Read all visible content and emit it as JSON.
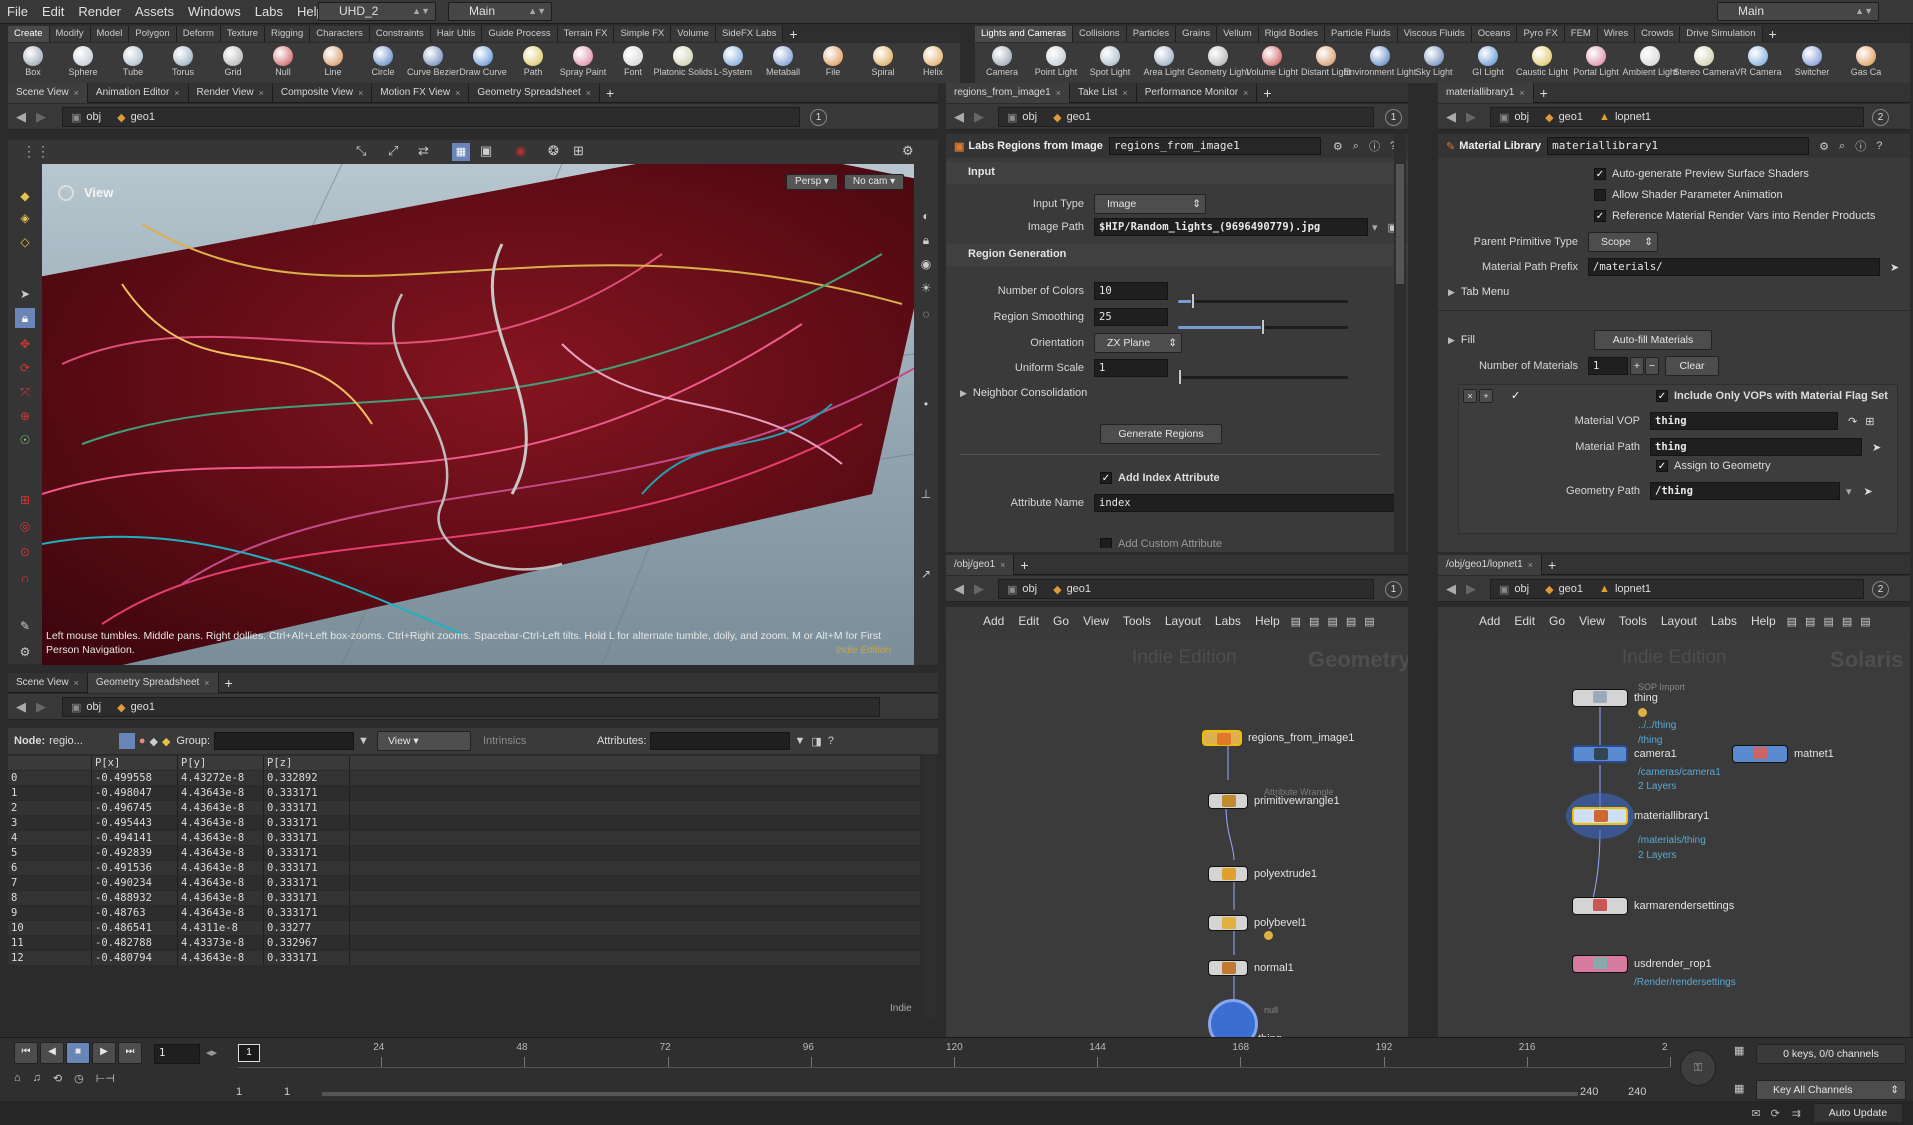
{
  "menu": {
    "items": [
      "File",
      "Edit",
      "Render",
      "Assets",
      "Windows",
      "Labs",
      "Help"
    ],
    "desktop": "UHD_2",
    "desk_main": "Main",
    "right_desk": "Main"
  },
  "shelf_left": {
    "tabs": [
      "Create",
      "Modify",
      "Model",
      "Polygon",
      "Deform",
      "Texture",
      "Rigging",
      "Characters",
      "Constraints",
      "Hair Utils",
      "Guide Process",
      "Terrain FX",
      "Simple FX",
      "Volume",
      "SideFX Labs"
    ],
    "tools": [
      "Box",
      "Sphere",
      "Tube",
      "Torus",
      "Grid",
      "Null",
      "Line",
      "Circle",
      "Curve Bezier",
      "Draw Curve",
      "Path",
      "Spray Paint",
      "Font",
      "Platonic Solids",
      "L-System",
      "Metaball",
      "File",
      "Spiral",
      "Helix"
    ]
  },
  "shelf_right": {
    "tabs": [
      "Lights and Cameras",
      "Collisions",
      "Particles",
      "Grains",
      "Vellum",
      "Rigid Bodies",
      "Particle Fluids",
      "Viscous Fluids",
      "Oceans",
      "Pyro FX",
      "FEM",
      "Wires",
      "Crowds",
      "Drive Simulation"
    ],
    "tools": [
      "Camera",
      "Point Light",
      "Spot Light",
      "Area Light",
      "Geometry Light",
      "Volume Light",
      "Distant Light",
      "Environment Light",
      "Sky Light",
      "GI Light",
      "Caustic Light",
      "Portal Light",
      "Ambient Light",
      "Stereo Camera",
      "VR Camera",
      "Switcher",
      "Gas Ca"
    ]
  },
  "viewer": {
    "tabs": [
      "Scene View",
      "Animation Editor",
      "Render View",
      "Composite View",
      "Motion FX View",
      "Geometry Spreadsheet"
    ],
    "path_obj": "obj",
    "path_geo": "geo1",
    "label": "View",
    "persp": "Persp",
    "cam": "No cam",
    "help": "Left mouse tumbles. Middle pans. Right dollies. Ctrl+Alt+Left box-zooms. Ctrl+Right zooms. Spacebar-Ctrl-Left tilts. Hold L for alternate tumble, dolly, and zoom. M or Alt+M for First Person Navigation.",
    "indie": "Indie Edition",
    "circ": "1"
  },
  "sheet": {
    "tabs": [
      "Scene View",
      "Geometry Spreadsheet"
    ],
    "node_label": "Node:",
    "node_name": "regio...",
    "group_label": "Group:",
    "view": "View",
    "intrinsics": "Intrinsics",
    "attributes": "Attributes:",
    "columns": [
      "",
      "P[x]",
      "P[y]",
      "P[z]"
    ],
    "rows": [
      [
        "0",
        "-0.499558",
        "4.43272e-8",
        "0.332892"
      ],
      [
        "1",
        "-0.498047",
        "4.43643e-8",
        "0.333171"
      ],
      [
        "2",
        "-0.496745",
        "4.43643e-8",
        "0.333171"
      ],
      [
        "3",
        "-0.495443",
        "4.43643e-8",
        "0.333171"
      ],
      [
        "4",
        "-0.494141",
        "4.43643e-8",
        "0.333171"
      ],
      [
        "5",
        "-0.492839",
        "4.43643e-8",
        "0.333171"
      ],
      [
        "6",
        "-0.491536",
        "4.43643e-8",
        "0.333171"
      ],
      [
        "7",
        "-0.490234",
        "4.43643e-8",
        "0.333171"
      ],
      [
        "8",
        "-0.488932",
        "4.43643e-8",
        "0.333171"
      ],
      [
        "9",
        "-0.48763",
        "4.43643e-8",
        "0.333171"
      ],
      [
        "10",
        "-0.486541",
        "4.4311e-8",
        "0.33277"
      ],
      [
        "11",
        "-0.482788",
        "4.43373e-8",
        "0.332967"
      ],
      [
        "12",
        "-0.480794",
        "4.43643e-8",
        "0.333171"
      ]
    ],
    "indie": "Indie"
  },
  "params": {
    "tabs": [
      "regions_from_image1",
      "Take List",
      "Performance Monitor"
    ],
    "path_obj": "obj",
    "path_geo": "geo1",
    "circ": "1",
    "type": "Labs Regions from Image",
    "name": "regions_from_image1",
    "input_section": "Input",
    "input_type_label": "Input Type",
    "input_type": "Image",
    "image_path_label": "Image Path",
    "image_path": "$HIP/Random_lights_(9696490779).jpg",
    "region_section": "Region Generation",
    "num_colors_label": "Number of Colors",
    "num_colors": "10",
    "smoothing_label": "Region Smoothing",
    "smoothing": "25",
    "orient_label": "Orientation",
    "orient": "ZX Plane",
    "uscale_label": "Uniform Scale",
    "uscale": "1",
    "neighbor": "Neighbor Consolidation",
    "generate": "Generate Regions",
    "add_index": "Add Index Attribute",
    "attr_name_label": "Attribute Name",
    "attr_name": "index",
    "add_custom": "Add Custom Attribute",
    "slider_colors": 0.09,
    "slider_smoothing": 0.5,
    "slider_uscale": 0.0
  },
  "matlib": {
    "tabs": [
      "materiallibrary1"
    ],
    "path_obj": "obj",
    "path_geo": "geo1",
    "path_lop": "lopnet1",
    "circ": "2",
    "type": "Material Library",
    "name": "materiallibrary1",
    "opt1": "Auto-generate Preview Surface Shaders",
    "opt2": "Allow Shader Parameter Animation",
    "opt3": "Reference Material Render Vars into Render Products",
    "prim_type_label": "Parent Primitive Type",
    "prim_type": "Scope",
    "mat_prefix_label": "Material Path Prefix",
    "mat_prefix": "/materials/",
    "tab_menu": "Tab Menu",
    "fill": "Fill",
    "autofill": "Auto-fill Materials",
    "num_mat_label": "Number of Materials",
    "num_mat": "1",
    "clear": "Clear",
    "include_only": "Include Only VOPs with Material Flag Set",
    "mat_vop_label": "Material VOP",
    "mat_vop": "thing",
    "mat_path_label": "Material Path",
    "mat_path": "thing",
    "assign": "Assign to Geometry",
    "geo_path_label": "Geometry Path",
    "geo_path": "/thing"
  },
  "net_geo": {
    "tab": "/obj/geo1",
    "path_obj": "obj",
    "path_geo": "geo1",
    "circ": "1",
    "menu": [
      "Add",
      "Edit",
      "Go",
      "View",
      "Tools",
      "Layout",
      "Labs",
      "Help"
    ],
    "wm_indie": "Indie Edition",
    "wm_type": "Geometry",
    "nodes": [
      {
        "name": "regions_from_image1"
      },
      {
        "name": "primitivewrangle1",
        "sub": "Attribute Wrangle"
      },
      {
        "name": "polyextrude1"
      },
      {
        "name": "polybevel1"
      },
      {
        "name": "normal1"
      },
      {
        "name": "thing",
        "sub": "null"
      }
    ]
  },
  "net_lop": {
    "tab": "/obj/geo1/lopnet1",
    "path_obj": "obj",
    "path_geo": "geo1",
    "path_lop": "lopnet1",
    "circ": "2",
    "menu": [
      "Add",
      "Edit",
      "Go",
      "View",
      "Tools",
      "Layout",
      "Labs",
      "Help"
    ],
    "wm_indie": "Indie Edition",
    "wm_type": "Solaris",
    "nodes": [
      {
        "name": "thing",
        "sub": "SOP Import",
        "info": "../../thing",
        "info2": "/thing"
      },
      {
        "name": "camera1",
        "info": "/cameras/camera1",
        "info2": "2 Layers"
      },
      {
        "name": "matnet1"
      },
      {
        "name": "materiallibrary1",
        "info": "/materials/thing",
        "info2": "2 Layers"
      },
      {
        "name": "karmarendersettings"
      },
      {
        "name": "usdrender_rop1",
        "info": "/Render/rendersettings"
      }
    ]
  },
  "timeline": {
    "frame": "1",
    "ticks": [
      "1",
      "24",
      "48",
      "72",
      "96",
      "120",
      "144",
      "168",
      "192",
      "216",
      "2"
    ],
    "start": "1",
    "start2": "1",
    "end": "240",
    "end2": "240",
    "keys": "0 keys, 0/0 channels",
    "key_all": "Key All Channels",
    "auto_update": "Auto Update"
  },
  "colors": {
    "accent": "#e8b04a",
    "selected_node": "#f0c000",
    "link": "#5aa9d6",
    "pink": "#d67aa0"
  }
}
